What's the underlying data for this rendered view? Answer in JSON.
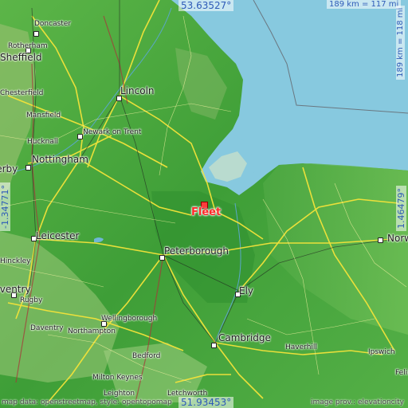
{
  "marker": {
    "name": "Fleet",
    "color": "#ff2a2a"
  },
  "bounds": {
    "north": "53.63527°",
    "south": "51.93453°",
    "west": "-1.34771°",
    "east": "1.46479°"
  },
  "scale": {
    "horizontal": "189 km = 117 mi",
    "vertical": "189 km = 118 mi"
  },
  "attribution_left": "map data: openstreetmap, style: opentopomap",
  "attribution_right": "image prov.: elevationcity",
  "colors": {
    "sea": "#87c9df",
    "land": "#43a43a",
    "highland": "#8dbd6a",
    "roads": "#f3e33a",
    "coordinates": "#2e5bb8"
  },
  "places": [
    {
      "name": "Doncaster"
    },
    {
      "name": "Rotherham"
    },
    {
      "name": "Sheffield"
    },
    {
      "name": "Chesterfield"
    },
    {
      "name": "Lincoln"
    },
    {
      "name": "Mansfield"
    },
    {
      "name": "Newark on Trent"
    },
    {
      "name": "Hucknall"
    },
    {
      "name": "Nottingham"
    },
    {
      "name": "Derby"
    },
    {
      "name": "Leicester"
    },
    {
      "name": "Hinckley"
    },
    {
      "name": "Coventry"
    },
    {
      "name": "Rugby"
    },
    {
      "name": "Daventry"
    },
    {
      "name": "Northampton"
    },
    {
      "name": "Wellingborough"
    },
    {
      "name": "Bedford"
    },
    {
      "name": "Milton Keynes"
    },
    {
      "name": "Leighton"
    },
    {
      "name": "Letchworth"
    },
    {
      "name": "Peterborough"
    },
    {
      "name": "Ely"
    },
    {
      "name": "Cambridge"
    },
    {
      "name": "Haverhill"
    },
    {
      "name": "Ipswich"
    },
    {
      "name": "Norwich"
    },
    {
      "name": "Felixstowe"
    }
  ]
}
